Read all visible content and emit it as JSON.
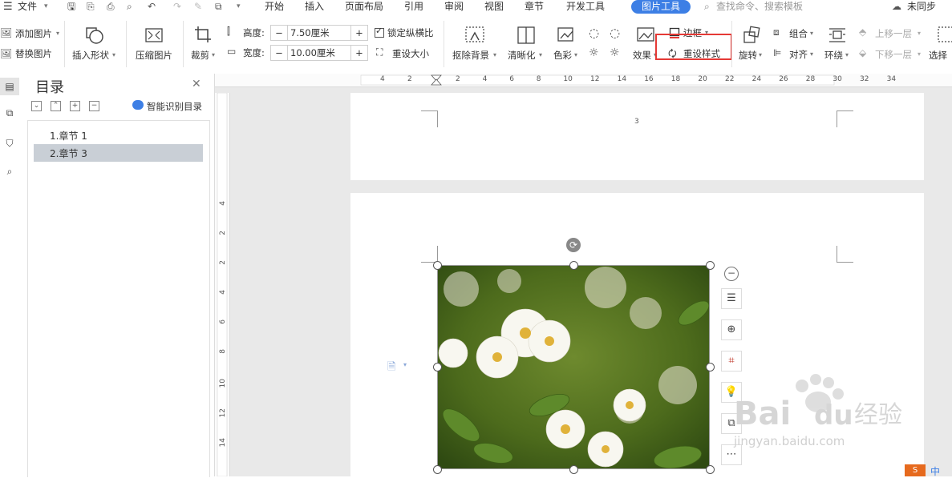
{
  "menubar": {
    "file": "文件",
    "tabs": [
      "开始",
      "插入",
      "页面布局",
      "引用",
      "审阅",
      "视图",
      "章节",
      "开发工具"
    ],
    "active_tab": "图片工具",
    "search_placeholder": "查找命令、搜索模板",
    "sync": "未同步"
  },
  "ribbon": {
    "add_picture": "添加图片",
    "replace_picture": "替换图片",
    "insert_shape": "插入形状",
    "compress_picture": "压缩图片",
    "crop": "裁剪",
    "height_label": "高度:",
    "height_value": "7.50厘米",
    "width_label": "宽度:",
    "width_value": "10.00厘米",
    "lock_ratio": "锁定纵横比",
    "reset_size": "重设大小",
    "remove_bg": "抠除背景",
    "sharpen": "清晰化",
    "color": "色彩",
    "effects": "效果",
    "border": "边框",
    "reset_style": "重设样式",
    "rotate": "旋转",
    "group": "组合",
    "align": "对齐",
    "wrap": "环绕",
    "bring_forward": "上移一层",
    "send_backward": "下移一层",
    "select": "选择"
  },
  "toc": {
    "title": "目录",
    "smart_toc": "智能识别目录",
    "items": [
      "1.章节 1",
      "2.章节 3"
    ],
    "selected_index": 1
  },
  "ruler": {
    "h_ticks": [
      "4",
      "2",
      "2",
      "4",
      "6",
      "8",
      "10",
      "12",
      "14",
      "16",
      "18",
      "20",
      "22",
      "24",
      "26",
      "28",
      "30",
      "32",
      "34"
    ],
    "v_ticks": [
      "4",
      "2",
      "2",
      "4",
      "6",
      "8",
      "10",
      "12",
      "14"
    ]
  },
  "document": {
    "page_number": "3"
  },
  "watermark": "Baidu经验 jingyan.baidu.com",
  "colors": {
    "accent": "#3d7fe5",
    "highlight_box": "#e53935",
    "toc_selected_bg": "#c9cfd6"
  }
}
